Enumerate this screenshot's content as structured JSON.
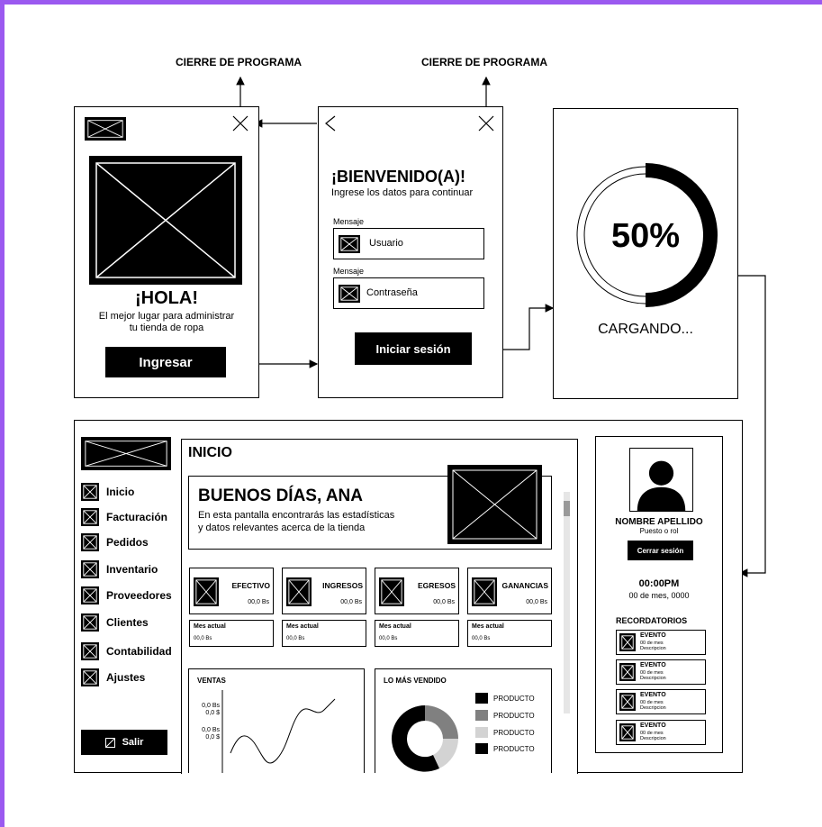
{
  "labels": {
    "close_program_1": "CIERRE DE PROGRAMA",
    "close_program_2": "CIERRE DE PROGRAMA"
  },
  "screen1": {
    "hello": "¡HOLA!",
    "tagline_1": "El mejor lugar para administrar",
    "tagline_2": "tu tienda de ropa",
    "enter_button": "Ingresar"
  },
  "screen2": {
    "welcome": "¡BIENVENIDO(A)!",
    "subtitle": "Ingrese los datos para continuar",
    "user_label": "Mensaje",
    "user_placeholder": "Usuario",
    "password_label": "Mensaje",
    "password_placeholder": "Contraseña",
    "login_button": "Iniciar sesión"
  },
  "screen3": {
    "progress_text": "50%",
    "progress_value": 0.5,
    "loading_text": "CARGANDO..."
  },
  "dashboard": {
    "sidebar": {
      "items": [
        "Inicio",
        "Facturación",
        "Pedidos",
        "Inventario",
        "Proveedores",
        "Clientes",
        "Contabilidad",
        "Ajustes"
      ],
      "logout": "Salir"
    },
    "main": {
      "title": "INICIO",
      "greeting": "BUENOS DÍAS, ANA",
      "greeting_sub_1": "En esta pantalla encontrarás las estadísticas",
      "greeting_sub_2": "y datos relevantes acerca de la tienda",
      "stats": [
        {
          "label": "EFECTIVO",
          "value": "00,0 Bs",
          "month_label": "Mes actual",
          "month_value": "00,0 Bs"
        },
        {
          "label": "INGRESOS",
          "value": "00,0 Bs",
          "month_label": "Mes actual",
          "month_value": "00,0 Bs"
        },
        {
          "label": "EGRESOS",
          "value": "00,0 Bs",
          "month_label": "Mes actual",
          "month_value": "00,0 Bs"
        },
        {
          "label": "GANANCIAS",
          "value": "00,0 Bs",
          "month_label": "Mes actual",
          "month_value": "00,0 Bs"
        }
      ],
      "sales_title": "VENTAS",
      "sales_axis": [
        "0,0 Bs",
        "0,0 $",
        "0,0 Bs",
        "0,0 $"
      ],
      "best_title": "LO MÁS VENDIDO",
      "best_items": [
        {
          "label": "PRODUCTO",
          "color": "#000000"
        },
        {
          "label": "PRODUCTO",
          "color": "#808080"
        },
        {
          "label": "PRODUCTO",
          "color": "#d3d3d3"
        },
        {
          "label": "PRODUCTO",
          "color": "#000000"
        }
      ]
    },
    "profile": {
      "name": "NOMBRE APELLIDO",
      "role": "Puesto o rol",
      "logout_button": "Cerrar sesión",
      "time": "00:00PM",
      "date": "00 de mes, 0000",
      "reminders_title": "RECORDATORIOS",
      "events": [
        {
          "title": "EVENTO",
          "date": "00 de mes",
          "desc": "Descripcion"
        },
        {
          "title": "EVENTO",
          "date": "00 de mes",
          "desc": "Descripcion"
        },
        {
          "title": "EVENTO",
          "date": "00 de mes",
          "desc": "Descripcion"
        },
        {
          "title": "EVENTO",
          "date": "00 de mes",
          "desc": "Descripcion"
        }
      ]
    }
  }
}
